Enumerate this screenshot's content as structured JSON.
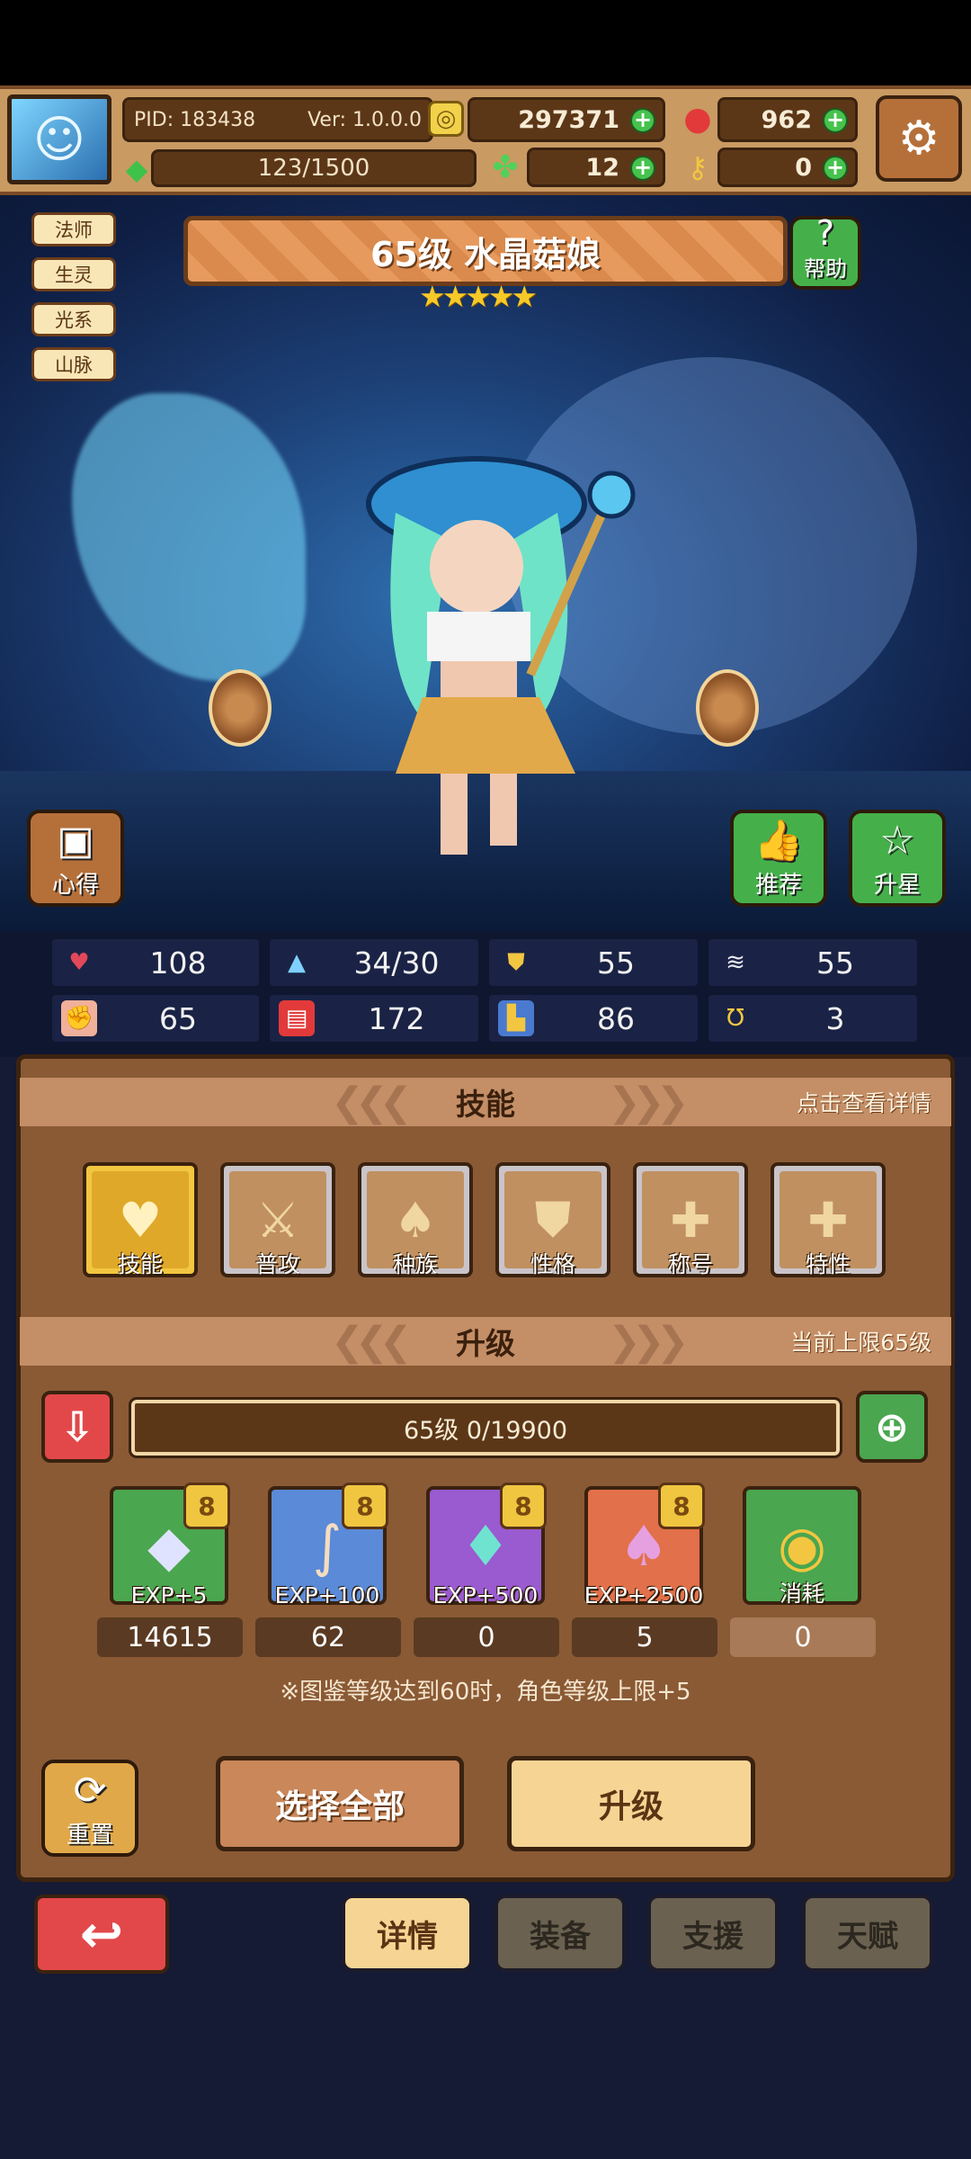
{
  "header": {
    "pid": "PID: 183438",
    "version": "Ver: 1.0.0.0",
    "gold": "297371",
    "gems": "962",
    "stamina": "123/1500",
    "clover": "12",
    "key": "0"
  },
  "hero": {
    "tags": [
      "法师",
      "生灵",
      "光系",
      "山脉"
    ],
    "title": "65级 水晶菇娘",
    "stars": "★★★★★",
    "help_label": "帮助",
    "insight_label": "心得",
    "recommend_label": "推荐",
    "star_up_label": "升星"
  },
  "stats": {
    "hp": "108",
    "mana": "34/30",
    "defense": "55",
    "speed": "55",
    "attack": "65",
    "magic": "172",
    "resist": "86",
    "luck": "3"
  },
  "skills": {
    "title": "技能",
    "note": "点击查看详情",
    "items": [
      "技能",
      "普攻",
      "种族",
      "性格",
      "称号",
      "特性"
    ]
  },
  "upgrade": {
    "title": "升级",
    "note": "当前上限65级",
    "level_text": "65级  0/19900",
    "items": [
      {
        "label": "EXP+5",
        "count": "14615"
      },
      {
        "label": "EXP+100",
        "count": "62"
      },
      {
        "label": "EXP+500",
        "count": "0"
      },
      {
        "label": "EXP+2500",
        "count": "5"
      },
      {
        "label": "消耗",
        "count": "0"
      }
    ],
    "notice": "※图鉴等级达到60时，角色等级上限+5",
    "reset_label": "重置",
    "select_all_label": "选择全部",
    "upgrade_label": "升级"
  },
  "bottom_tabs": [
    "详情",
    "装备",
    "支援",
    "天赋"
  ],
  "colors": {
    "accent": "#c48e66",
    "panel": "#8a5a35",
    "back": "#e2484a",
    "green": "#4aa64f"
  }
}
